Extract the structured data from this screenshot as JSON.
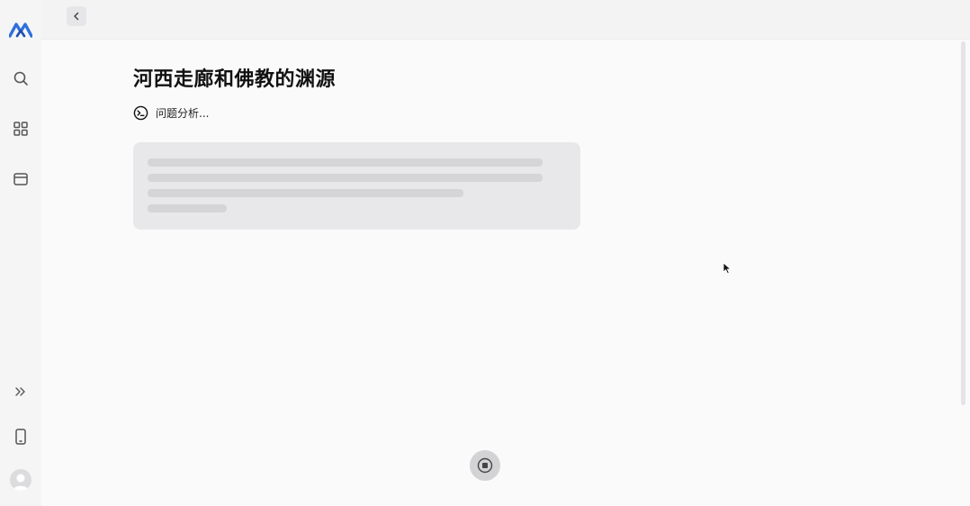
{
  "sidebar": {
    "items": [
      {
        "name": "logo",
        "icon": "brand-logo-icon"
      },
      {
        "name": "search",
        "icon": "search-icon"
      },
      {
        "name": "apps",
        "icon": "grid-icon"
      },
      {
        "name": "window",
        "icon": "window-icon"
      },
      {
        "name": "expand",
        "icon": "double-chevron-right-icon"
      },
      {
        "name": "mobile",
        "icon": "phone-icon"
      },
      {
        "name": "avatar",
        "icon": "user-icon"
      }
    ]
  },
  "header": {
    "collapse_icon": "chevron-left-icon"
  },
  "main": {
    "title": "河西走廊和佛教的渊源",
    "status": {
      "icon": "terminal-icon",
      "text": "问题分析..."
    },
    "skeleton_lines": 4
  },
  "controls": {
    "stop_icon": "stop-icon"
  },
  "colors": {
    "brand": "#2f6fdc",
    "background": "#f3f3f4",
    "panel": "#fafafa",
    "skeleton_card": "#e8e8ea",
    "skeleton_line": "#d5d5d7"
  }
}
